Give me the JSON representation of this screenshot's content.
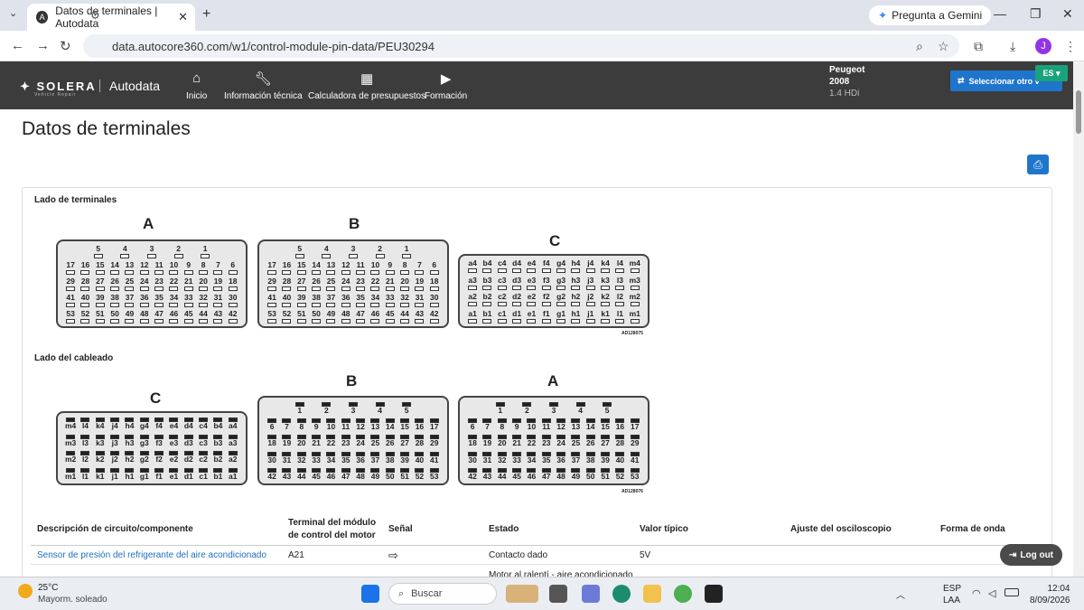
{
  "browser": {
    "tab_title": "Datos de terminales | Autodata",
    "url": "data.autocore360.com/w1/control-module-pin-data/PEU30294",
    "gemini_label": "Pregunta a Gemini",
    "avatar_letter": "J"
  },
  "app": {
    "logo_text": "SOLERA",
    "logo_sub": "Vehicle Repair",
    "brand": "Autodata",
    "nav": [
      {
        "label": "Inicio",
        "icon": "home-icon"
      },
      {
        "label": "Información técnica",
        "icon": "wrench-icon"
      },
      {
        "label": "Calculadora de presupuestos",
        "icon": "calculator-icon"
      },
      {
        "label": "Formación",
        "icon": "play-icon"
      }
    ],
    "vehicle": {
      "make": "Peugeot",
      "year": "2008",
      "engine": "1.4 HDi"
    },
    "select_vehicle_label": "Seleccionar otro v",
    "lang": "ES"
  },
  "page": {
    "title": "Datos de terminales",
    "terminal_side_label": "Lado de terminales",
    "wiring_side_label": "Lado del cableado",
    "ref1": "AD128075",
    "ref2": "AD128076"
  },
  "connectors": {
    "terminal_side": [
      {
        "label": "A",
        "rows": [
          [
            "5",
            "4",
            "3",
            "2",
            "1"
          ],
          [
            "17",
            "16",
            "15",
            "14",
            "13",
            "12",
            "11",
            "10",
            "9",
            "8",
            "7",
            "6"
          ],
          [
            "29",
            "28",
            "27",
            "26",
            "25",
            "24",
            "23",
            "22",
            "21",
            "20",
            "19",
            "18"
          ],
          [
            "41",
            "40",
            "39",
            "38",
            "37",
            "36",
            "35",
            "34",
            "33",
            "32",
            "31",
            "30"
          ],
          [
            "53",
            "52",
            "51",
            "50",
            "49",
            "48",
            "47",
            "46",
            "45",
            "44",
            "43",
            "42"
          ]
        ]
      },
      {
        "label": "B",
        "rows": [
          [
            "5",
            "4",
            "3",
            "2",
            "1"
          ],
          [
            "17",
            "16",
            "15",
            "14",
            "13",
            "12",
            "11",
            "10",
            "9",
            "8",
            "7",
            "6"
          ],
          [
            "29",
            "28",
            "27",
            "26",
            "25",
            "24",
            "23",
            "22",
            "21",
            "20",
            "19",
            "18"
          ],
          [
            "41",
            "40",
            "39",
            "38",
            "37",
            "36",
            "35",
            "34",
            "33",
            "32",
            "31",
            "30"
          ],
          [
            "53",
            "52",
            "51",
            "50",
            "49",
            "48",
            "47",
            "46",
            "45",
            "44",
            "43",
            "42"
          ]
        ]
      },
      {
        "label": "C",
        "rows": [
          [
            "a4",
            "b4",
            "c4",
            "d4",
            "e4",
            "f4",
            "g4",
            "h4",
            "j4",
            "k4",
            "l4",
            "m4"
          ],
          [
            "a3",
            "b3",
            "c3",
            "d3",
            "e3",
            "f3",
            "g3",
            "h3",
            "j3",
            "k3",
            "l3",
            "m3"
          ],
          [
            "a2",
            "b2",
            "c2",
            "d2",
            "e2",
            "f2",
            "g2",
            "h2",
            "j2",
            "k2",
            "l2",
            "m2"
          ],
          [
            "a1",
            "b1",
            "c1",
            "d1",
            "e1",
            "f1",
            "g1",
            "h1",
            "j1",
            "k1",
            "l1",
            "m1"
          ]
        ]
      }
    ],
    "wiring_side": [
      {
        "label": "C",
        "rows": [
          [
            "m4",
            "l4",
            "k4",
            "j4",
            "h4",
            "g4",
            "f4",
            "e4",
            "d4",
            "c4",
            "b4",
            "a4"
          ],
          [
            "m3",
            "l3",
            "k3",
            "j3",
            "h3",
            "g3",
            "f3",
            "e3",
            "d3",
            "c3",
            "b3",
            "a3"
          ],
          [
            "m2",
            "l2",
            "k2",
            "j2",
            "h2",
            "g2",
            "f2",
            "e2",
            "d2",
            "c2",
            "b2",
            "a2"
          ],
          [
            "m1",
            "l1",
            "k1",
            "j1",
            "h1",
            "g1",
            "f1",
            "e1",
            "d1",
            "c1",
            "b1",
            "a1"
          ]
        ]
      },
      {
        "label": "B",
        "rows": [
          [
            "1",
            "2",
            "3",
            "4",
            "5"
          ],
          [
            "6",
            "7",
            "8",
            "9",
            "10",
            "11",
            "12",
            "13",
            "14",
            "15",
            "16",
            "17"
          ],
          [
            "18",
            "19",
            "20",
            "21",
            "22",
            "23",
            "24",
            "25",
            "26",
            "27",
            "28",
            "29"
          ],
          [
            "30",
            "31",
            "32",
            "33",
            "34",
            "35",
            "36",
            "37",
            "38",
            "39",
            "40",
            "41"
          ],
          [
            "42",
            "43",
            "44",
            "45",
            "46",
            "47",
            "48",
            "49",
            "50",
            "51",
            "52",
            "53"
          ]
        ]
      },
      {
        "label": "A",
        "rows": [
          [
            "1",
            "2",
            "3",
            "4",
            "5"
          ],
          [
            "6",
            "7",
            "8",
            "9",
            "10",
            "11",
            "12",
            "13",
            "14",
            "15",
            "16",
            "17"
          ],
          [
            "18",
            "19",
            "20",
            "21",
            "22",
            "23",
            "24",
            "25",
            "26",
            "27",
            "28",
            "29"
          ],
          [
            "30",
            "31",
            "32",
            "33",
            "34",
            "35",
            "36",
            "37",
            "38",
            "39",
            "40",
            "41"
          ],
          [
            "42",
            "43",
            "44",
            "45",
            "46",
            "47",
            "48",
            "49",
            "50",
            "51",
            "52",
            "53"
          ]
        ]
      }
    ]
  },
  "table": {
    "headers": [
      "Descripción de circuito/componente",
      "Terminal del módulo de control del motor",
      "Señal",
      "Estado",
      "Valor típico",
      "Ajuste del osciloscopio",
      "Forma de onda"
    ],
    "rows": [
      {
        "desc": "Sensor de presión del refrigerante del aire acondicionado",
        "terminal": "A21",
        "signal_icon": "arrow-right-icon",
        "state": "Contacto dado",
        "value": "5V"
      }
    ],
    "partial_next_state": "Motor al ralentí - aire acondicionado"
  },
  "logout_label": "Log out",
  "taskbar": {
    "temp": "25°C",
    "weather": "Mayorm. soleado",
    "search": "Buscar",
    "lang1": "ESP",
    "lang2": "LAA",
    "time": "12:04",
    "date": "8/09/2026"
  }
}
